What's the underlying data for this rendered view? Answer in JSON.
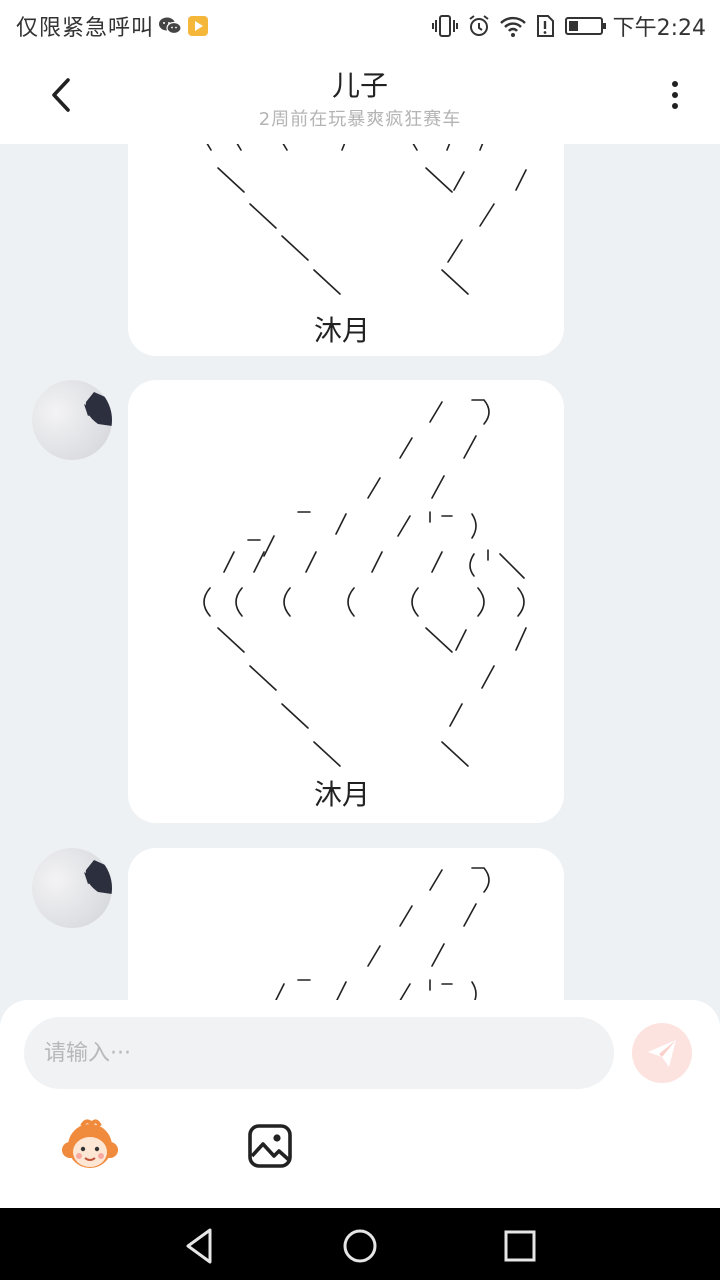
{
  "status_bar": {
    "left_text": "仅限紧急呼叫",
    "time": "下午2:24"
  },
  "header": {
    "title": "儿子",
    "subtitle": "2周前在玩暴爽疯狂赛车"
  },
  "messages": [
    {
      "signature": "沐月"
    },
    {
      "signature": "沐月"
    },
    {
      "signature": ""
    }
  ],
  "input": {
    "placeholder": "请输入···"
  },
  "colors": {
    "background": "#eef1f4",
    "send_button": "#fde3e0"
  }
}
